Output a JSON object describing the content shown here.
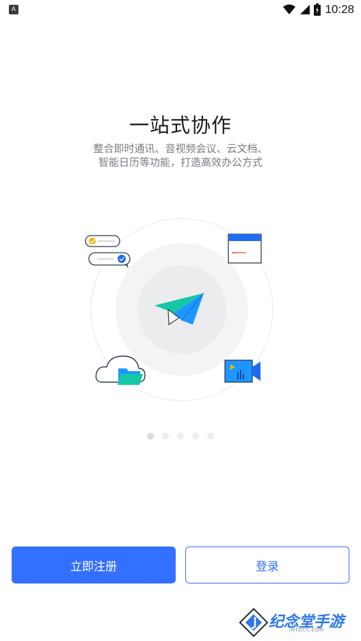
{
  "status_bar": {
    "time": "10:28",
    "left_icon": "A"
  },
  "onboarding": {
    "title": "一站式协作",
    "subtitle_lines": [
      "整合即时通讯、音视频会议、云文档、",
      "智能日历等功能，打造高效办公方式"
    ],
    "pages_total": 5,
    "current_page": 1
  },
  "actions": {
    "register_label": "立即注册",
    "login_label": "登录"
  },
  "watermark": {
    "text": "纪念堂手游",
    "sub": "JNTDCC.COM"
  },
  "colors": {
    "accent": "#3370ff",
    "plane_teal": "#14c7a6",
    "plane_blue": "#1e96ff"
  }
}
